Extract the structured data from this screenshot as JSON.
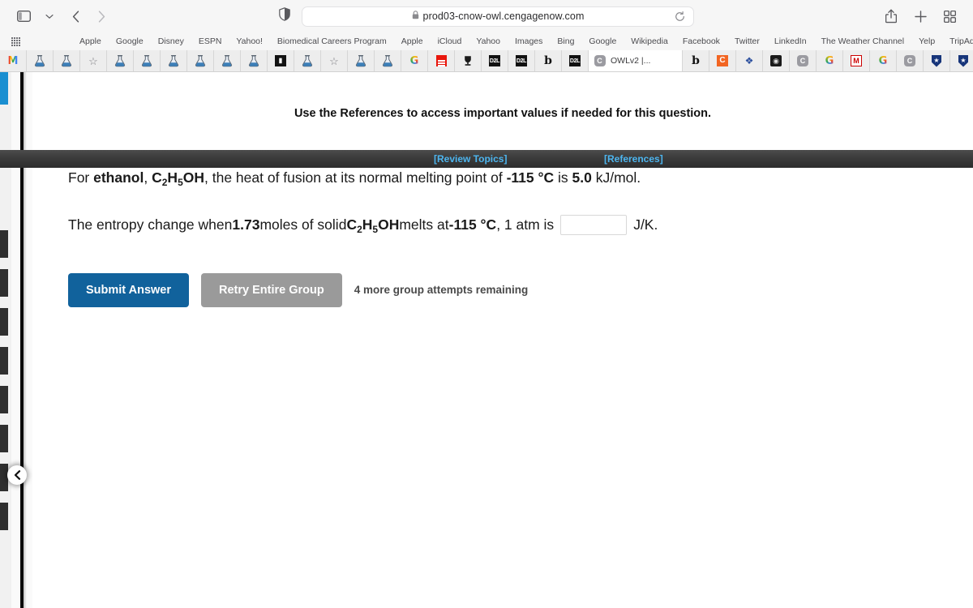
{
  "browser": {
    "toolbar": {
      "sidebar_toggle": "sidebar-toggle-icon",
      "tab_group_chevron": "chevron-down-icon",
      "back": "back-arrow-icon",
      "forward": "forward-arrow-icon",
      "shield": "privacy-shield-icon",
      "lock": "lock-icon",
      "url": "prod03-cnow-owl.cengagenow.com",
      "reload": "reload-icon",
      "share": "share-icon",
      "new_tab": "plus-icon",
      "tab_overview": "tab-overview-icon"
    },
    "favorites": [
      "Apple",
      "Google",
      "Disney",
      "ESPN",
      "Yahoo!",
      "Biomedical Careers Program",
      "Apple",
      "iCloud",
      "Yahoo",
      "Images",
      "Bing",
      "Google",
      "Wikipedia",
      "Facebook",
      "Twitter",
      "LinkedIn",
      "The Weather Channel",
      "Yelp",
      "TripAdvisor"
    ],
    "tabs": [
      {
        "icon": "gmail-icon",
        "title": "",
        "active": false
      },
      {
        "icon": "flask-icon",
        "title": "",
        "active": false
      },
      {
        "icon": "flask-icon",
        "title": "",
        "active": false
      },
      {
        "icon": "star-icon",
        "title": "",
        "active": false
      },
      {
        "icon": "flask-icon",
        "title": "",
        "active": false
      },
      {
        "icon": "flask-icon",
        "title": "",
        "active": false
      },
      {
        "icon": "flask-icon",
        "title": "",
        "active": false
      },
      {
        "icon": "flask-icon",
        "title": "",
        "active": false
      },
      {
        "icon": "flask-icon",
        "title": "",
        "active": false
      },
      {
        "icon": "flask-icon",
        "title": "",
        "active": false
      },
      {
        "icon": "pen-black-icon",
        "title": "",
        "active": false
      },
      {
        "icon": "flask-icon",
        "title": "",
        "active": false
      },
      {
        "icon": "star-icon",
        "title": "",
        "active": false
      },
      {
        "icon": "flask-icon",
        "title": "",
        "active": false
      },
      {
        "icon": "flask-icon",
        "title": "",
        "active": false
      },
      {
        "icon": "google-icon",
        "title": "",
        "active": false
      },
      {
        "icon": "red-doc-icon",
        "title": "",
        "active": false
      },
      {
        "icon": "trophy-icon",
        "title": "",
        "active": false
      },
      {
        "icon": "d2l-icon",
        "title": "",
        "active": false
      },
      {
        "icon": "d2l-icon",
        "title": "",
        "active": false
      },
      {
        "icon": "blackboard-icon",
        "title": "",
        "active": false
      },
      {
        "icon": "d2l-icon",
        "title": "",
        "active": false
      },
      {
        "icon": "cengage-icon",
        "title": "OWLv2 |...",
        "active": true
      },
      {
        "icon": "blackboard-icon",
        "title": "",
        "active": false
      },
      {
        "icon": "canvas-icon",
        "title": "",
        "active": false
      },
      {
        "icon": "burst-icon",
        "title": "",
        "active": false
      },
      {
        "icon": "dark-seal-icon",
        "title": "",
        "active": false
      },
      {
        "icon": "cengage-icon",
        "title": "",
        "active": false
      },
      {
        "icon": "google-icon",
        "title": "",
        "active": false
      },
      {
        "icon": "mcgraw-icon",
        "title": "",
        "active": false
      },
      {
        "icon": "google-icon",
        "title": "",
        "active": false
      },
      {
        "icon": "cengage-icon",
        "title": "",
        "active": false
      },
      {
        "icon": "shield-star-icon",
        "title": "",
        "active": false
      },
      {
        "icon": "shield-star-icon",
        "title": "",
        "active": false
      },
      {
        "icon": "gmail-icon",
        "title": "",
        "active": false
      }
    ]
  },
  "page": {
    "navbar": {
      "review_topics": "[Review Topics]",
      "references": "[References]",
      "link_color": "#4db6f0",
      "bar_color": "#3a3a3a"
    },
    "notice": "Use the References to access important values if needed for this question.",
    "question": {
      "line1": {
        "p1": "For ",
        "substance_name": "ethanol",
        "p2": ", ",
        "formula_c": "C",
        "formula_sub1": "2",
        "formula_h": "H",
        "formula_sub2": "5",
        "formula_oh": "OH",
        "p3": ", the heat of fusion at its normal melting point of ",
        "melting_point": "-115 °C",
        "p4": " is ",
        "heat_of_fusion": "5.0",
        "p5": " kJ/mol."
      },
      "line2": {
        "p1": "The entropy change when ",
        "moles": "1.73",
        "p2": " moles of solid ",
        "formula_c": "C",
        "formula_sub1": "2",
        "formula_h": "H",
        "formula_sub2": "5",
        "formula_oh": "OH",
        "p3": " melts at ",
        "melting_point": "-115 °C",
        "p4": ", 1 atm is",
        "answer_value": "",
        "answer_placeholder": "",
        "units": "J/K."
      }
    },
    "actions": {
      "submit_label": "Submit Answer",
      "retry_label": "Retry Entire Group",
      "attempts_text": "4 more group attempts remaining",
      "submit_color": "#11629c",
      "retry_color": "#9a9a9a"
    },
    "sidebar": {
      "collapse_icon": "chevron-left-icon",
      "accent_color": "#1a8fd1"
    }
  }
}
